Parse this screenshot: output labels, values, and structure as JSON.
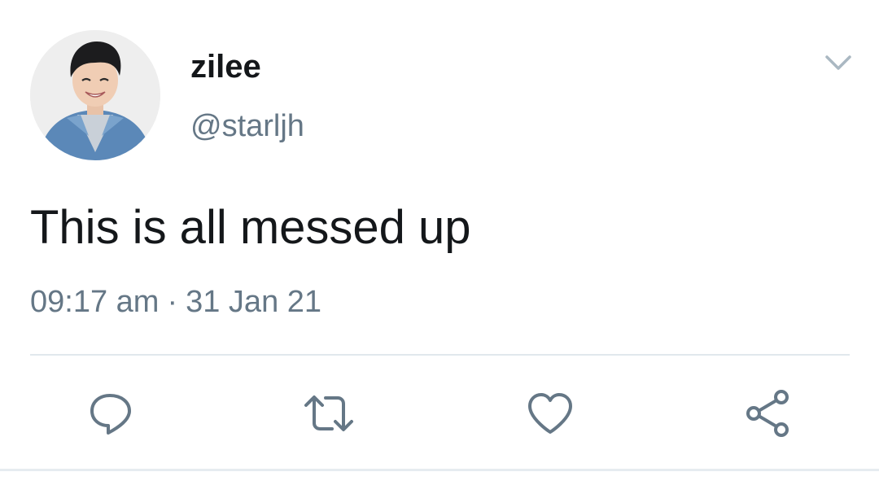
{
  "author": {
    "display_name": "zilee",
    "handle": "@starljh",
    "avatar_icon": "profile-photo"
  },
  "tweet": {
    "text": "This is all messed up",
    "time": "09:17 am",
    "separator": "·",
    "date": "31 Jan 21"
  },
  "actions": [
    {
      "icon": "reply-icon"
    },
    {
      "icon": "retweet-icon"
    },
    {
      "icon": "like-icon"
    },
    {
      "icon": "share-icon"
    }
  ],
  "colors": {
    "text_primary": "#14171a",
    "text_secondary": "#657786",
    "icon": "#657786",
    "divider": "#e1e8ed"
  }
}
